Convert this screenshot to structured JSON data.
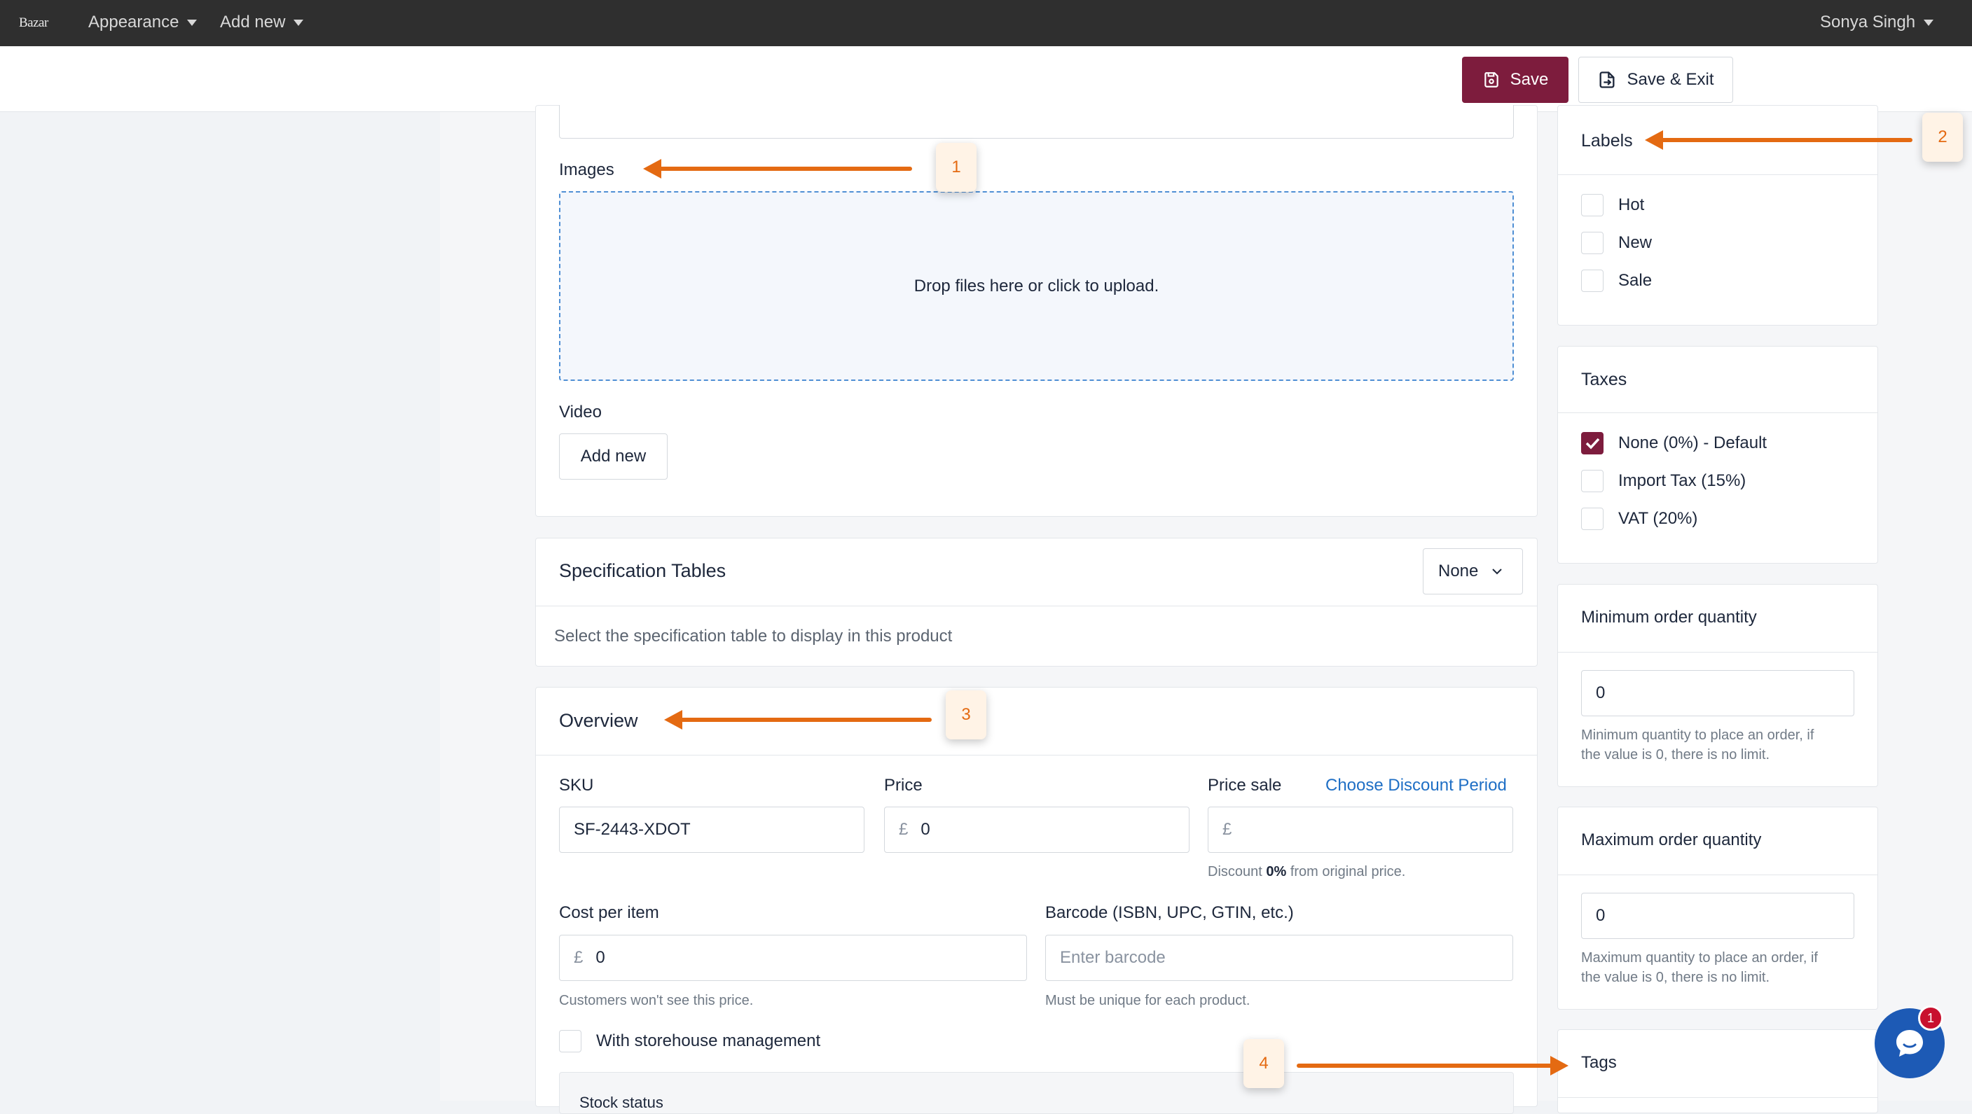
{
  "topbar": {
    "logo": "Bazar",
    "menu": [
      "Appearance",
      "Add new"
    ],
    "user": "Sonya Singh"
  },
  "actions": {
    "save": "Save",
    "save_exit": "Save & Exit"
  },
  "media": {
    "images_label": "Images",
    "dropzone_text": "Drop files here or click to upload.",
    "video_label": "Video",
    "add_new": "Add new"
  },
  "spec": {
    "title": "Specification Tables",
    "select_value": "None",
    "hint": "Select the specification table to display in this product"
  },
  "overview": {
    "title": "Overview",
    "sku_label": "SKU",
    "sku_value": "SF-2443-XDOT",
    "price_label": "Price",
    "currency": "£",
    "price_value": "0",
    "price_sale_label": "Price sale",
    "discount_link": "Choose Discount Period",
    "discount_prefix": "Discount",
    "discount_value": "0%",
    "discount_suffix": "from original price.",
    "cost_label": "Cost per item",
    "cost_value": "0",
    "cost_hint": "Customers won't see this price.",
    "barcode_label": "Barcode (ISBN, UPC, GTIN, etc.)",
    "barcode_placeholder": "Enter barcode",
    "barcode_hint": "Must be unique for each product.",
    "storehouse_label": "With storehouse management",
    "stock_status_label": "Stock status"
  },
  "sidebar": {
    "labels_title": "Labels",
    "labels": [
      {
        "label": "Hot",
        "checked": false
      },
      {
        "label": "New",
        "checked": false
      },
      {
        "label": "Sale",
        "checked": false
      }
    ],
    "taxes_title": "Taxes",
    "taxes": [
      {
        "label": "None (0%) - Default",
        "checked": true
      },
      {
        "label": "Import Tax (15%)",
        "checked": false
      },
      {
        "label": "VAT (20%)",
        "checked": false
      }
    ],
    "min_title": "Minimum order quantity",
    "min_value": "0",
    "min_hint_1": "Minimum quantity to place an order, if",
    "min_hint_2": "the value is 0, there is no limit.",
    "max_title": "Maximum order quantity",
    "max_value": "0",
    "max_hint_1": "Maximum quantity to place an order, if",
    "max_hint_2": "the value is 0, there is no limit.",
    "tags_title": "Tags"
  },
  "annotations": [
    "1",
    "2",
    "3",
    "4"
  ],
  "chat_badge": "1",
  "colors": {
    "brand": "#7d1c3d",
    "annotation": "#e46a12",
    "link": "#1f6fc5",
    "chat": "#1d5ab5"
  }
}
